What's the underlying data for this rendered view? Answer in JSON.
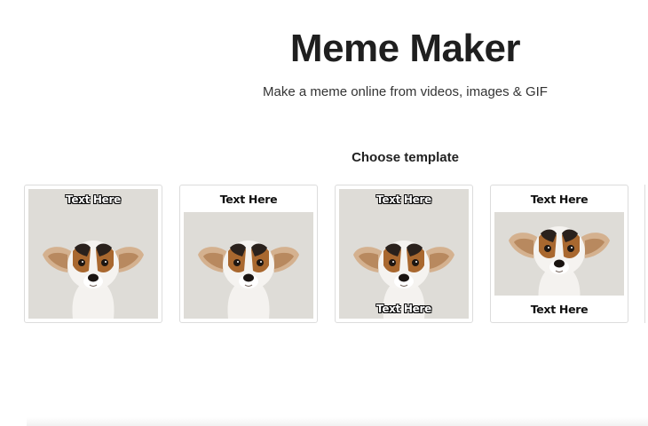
{
  "header": {
    "title": "Meme Maker",
    "subtitle": "Make a meme online from videos, images & GIF"
  },
  "templates": {
    "heading": "Choose template",
    "cards": [
      {
        "style": "overlay-top",
        "top_text": "Text Here",
        "bottom_text": ""
      },
      {
        "style": "caption-bar-top",
        "top_text": "Text Here",
        "bottom_text": ""
      },
      {
        "style": "overlay-top-bottom",
        "top_text": "Text Here",
        "bottom_text": "Text Here"
      },
      {
        "style": "caption-bars-top-bottom",
        "top_text": "Text Here",
        "bottom_text": "Text Here"
      }
    ]
  },
  "colors": {
    "photo_background": "#dedcd7",
    "card_border": "#dcdcdc"
  },
  "icons": [
    "dog-photo"
  ]
}
